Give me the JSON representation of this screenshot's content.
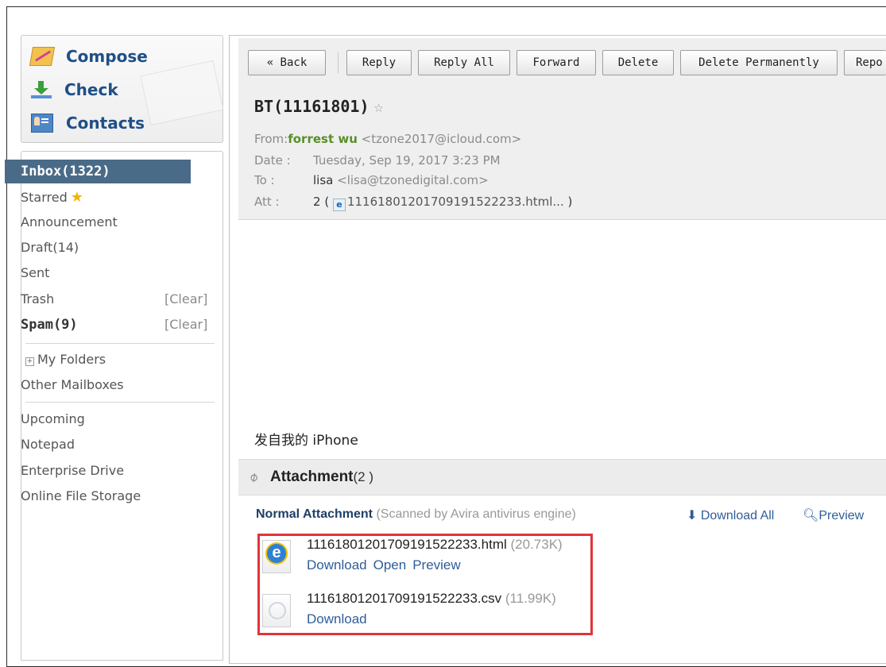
{
  "quick_actions": {
    "compose": "Compose",
    "check": "Check",
    "contacts": "Contacts"
  },
  "nav": {
    "inbox": "Inbox(1322)",
    "starred": "Starred",
    "announcement": "Announcement",
    "draft": "Draft(14)",
    "sent": "Sent",
    "trash": "Trash",
    "spam": "Spam(9)",
    "clear": "[Clear]",
    "my_folders": "My Folders",
    "other_mailboxes": "Other Mailboxes",
    "upcoming": "Upcoming",
    "notepad": "Notepad",
    "enterprise_drive": "Enterprise Drive",
    "online_file_storage": "Online File Storage"
  },
  "toolbar": {
    "back": "« Back",
    "reply": "Reply",
    "reply_all": "Reply All",
    "forward": "Forward",
    "delete": "Delete",
    "delete_permanently": "Delete Permanently",
    "report": "Repo"
  },
  "message": {
    "subject": "BT(11161801)",
    "from_label": "From:",
    "from_name": "forrest wu",
    "from_email": "<tzone2017@icloud.com>",
    "date_label": "Date :",
    "date_value": "Tuesday, Sep 19, 2017 3:23 PM",
    "to_label": "To :",
    "to_name": "lisa",
    "to_email": "<lisa@tzonedigital.com>",
    "att_label": "Att :",
    "att_count": "2",
    "att_open": "(",
    "att_file": "11161801201709191522233.html...",
    "att_close": ")",
    "body": "发自我的 iPhone"
  },
  "attachments": {
    "title": "Attachment",
    "count": "(2 )",
    "normal_label": "Normal Attachment",
    "scanned_note": "(Scanned by Avira antivirus engine)",
    "download_all": "Download All",
    "preview": "Preview",
    "files": [
      {
        "name": "11161801201709191522233.html",
        "size": "(20.73K)",
        "download": "Download",
        "open": "Open",
        "preview": "Preview"
      },
      {
        "name": "11161801201709191522233.csv",
        "size": "(11.99K)",
        "download": "Download"
      }
    ]
  }
}
